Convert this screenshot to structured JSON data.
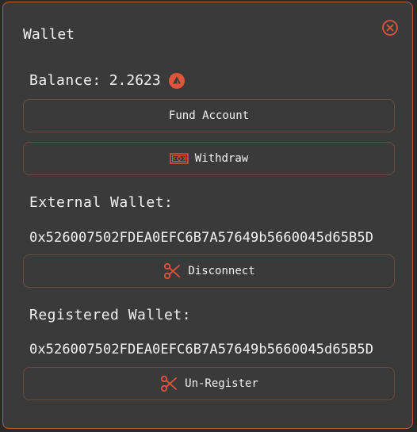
{
  "dialog": {
    "title": "Wallet",
    "close_icon": "close-circle-icon"
  },
  "balance": {
    "label": "Balance:",
    "value": "2.2623",
    "token_icon": "avalanche-icon"
  },
  "buttons": {
    "fund": "Fund Account",
    "withdraw": "Withdraw",
    "disconnect": "Disconnect",
    "unregister": "Un-Register"
  },
  "external_wallet": {
    "label": "External Wallet:",
    "address": "0x526007502FDEA0EFC6B7A57649b5660045d65B5D"
  },
  "registered_wallet": {
    "label": "Registered Wallet:",
    "address": "0x526007502FDEA0EFC6B7A57649b5660045d65B5D"
  },
  "colors": {
    "accent": "#e0553a",
    "panel": "#3a3a3a",
    "border": "#b85a3e"
  }
}
